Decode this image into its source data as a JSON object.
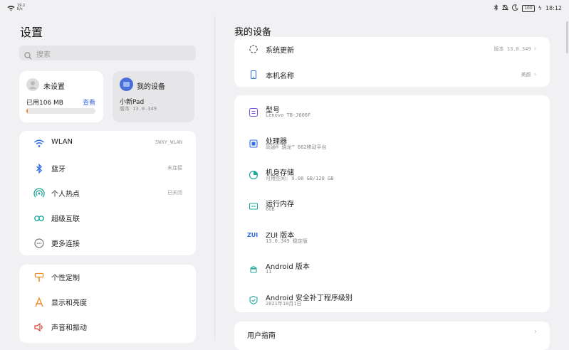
{
  "status_bar": {
    "net_up": "19.2",
    "net_down": "K/s",
    "time": "18:12",
    "battery": "100"
  },
  "left": {
    "title": "设置",
    "search_placeholder": "搜索",
    "account": {
      "name": "未设置",
      "storage_used": "已用106 MB",
      "view_link": "查看",
      "storage_progress": 0.02
    },
    "device": {
      "title": "我的设备",
      "model": "小新Pad",
      "version": "版本 13.0.349"
    },
    "connectivity": [
      {
        "label": "WLAN",
        "value": "SWXY_WLAN",
        "icon": "wifi-icon"
      },
      {
        "label": "蓝牙",
        "value": "未连接",
        "icon": "bluetooth-icon"
      },
      {
        "label": "个人热点",
        "value": "已关闭",
        "icon": "hotspot-icon"
      },
      {
        "label": "超级互联",
        "value": "",
        "icon": "super-connect-icon"
      },
      {
        "label": "更多连接",
        "value": "",
        "icon": "more-connections-icon"
      }
    ],
    "personal": [
      {
        "label": "个性定制",
        "icon": "personalize-icon"
      },
      {
        "label": "显示和亮度",
        "icon": "display-icon"
      },
      {
        "label": "声音和振动",
        "icon": "sound-icon"
      }
    ]
  },
  "right": {
    "title": "我的设备",
    "top_items": [
      {
        "label": "系统更新",
        "value": "版本 13.0.349",
        "icon": "system-update-icon"
      },
      {
        "label": "本机名称",
        "value": "美颜",
        "icon": "device-name-icon"
      }
    ],
    "info_items": [
      {
        "label": "型号",
        "sub": "Lenovo TB-J606F",
        "icon": "model-icon"
      },
      {
        "label": "处理器",
        "sub": "高通® 骁龙™ 662移动平台",
        "icon": "processor-icon"
      },
      {
        "label": "机身存储",
        "sub": "可用空间: 9.08 GB/128 GB",
        "icon": "storage-icon"
      },
      {
        "label": "运行内存",
        "sub": "6GB",
        "icon": "memory-icon"
      },
      {
        "label": "ZUI 版本",
        "sub": "13.0.349 稳定版",
        "icon": "zui-icon"
      },
      {
        "label": "Android 版本",
        "sub": "11",
        "icon": "android-icon"
      },
      {
        "label": "Android 安全补丁程序级别",
        "sub": "2021年10月1日",
        "icon": "security-patch-icon"
      }
    ],
    "guide": "用户指南"
  },
  "colors": {
    "accent": "#3d6fe0",
    "progress": "#f28a2c",
    "teal": "#1fa89a"
  }
}
